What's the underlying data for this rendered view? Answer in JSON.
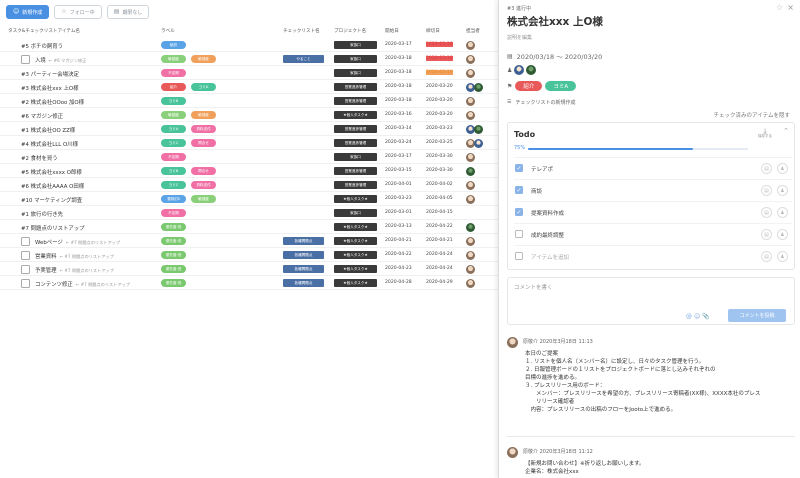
{
  "toolbar": {
    "new_label": "新規作成",
    "follow_label": "フォロー中",
    "nodue_label": "期限なし"
  },
  "table": {
    "headers": [
      "タスク&チェックリストアイテム名",
      "ラベル",
      "チェックリスト名",
      "プロジェクト名",
      "開始日",
      "締切日",
      "担当者"
    ],
    "rows": [
      {
        "title": "#5 ボチの飼育う",
        "sub": "",
        "labels": [
          {
            "t": "秘訳",
            "c": "blue"
          }
        ],
        "checklist": "",
        "project": "家族口",
        "start": "2020-03-17",
        "due": "2020-03-18",
        "due_color": "red",
        "avatars": [
          "a"
        ]
      },
      {
        "title": "入境",
        "sub": "← #6 マガジン修正",
        "checkbox": true,
        "labels": [
          {
            "t": "敏感度",
            "c": "lgreen"
          },
          {
            "t": "敏感度",
            "c": "orange"
          }
        ],
        "checklist": "やること",
        "project": "家族口",
        "start": "2020-03-18",
        "due": "2020-03-18",
        "due_color": "red",
        "avatars": [
          "a"
        ]
      },
      {
        "title": "#3 パーティー会場決定",
        "sub": "",
        "labels": [
          {
            "t": "不定期",
            "c": "pink"
          }
        ],
        "checklist": "",
        "project": "家族口",
        "start": "2020-03-18",
        "due": "2020-03-19",
        "due_color": "orange",
        "avatars": [
          "a"
        ]
      },
      {
        "title": "#3 株式会社xxx 上O様",
        "sub": "",
        "labels": [
          {
            "t": "紹介",
            "c": "red"
          },
          {
            "t": "ヨミA",
            "c": "teal"
          }
        ],
        "checklist": "",
        "project": "営業進捗管理",
        "start": "2020-03-18",
        "due": "2020-03-20",
        "due_color": "",
        "avatars": [
          "c",
          "b"
        ]
      },
      {
        "title": "#2 株式会社OOoo 加O様",
        "sub": "",
        "labels": [
          {
            "t": "ヨミB",
            "c": "teal"
          }
        ],
        "checklist": "",
        "project": "営業進捗管理",
        "start": "2020-03-18",
        "due": "2020-03-20",
        "due_color": "",
        "avatars": [
          "a"
        ]
      },
      {
        "title": "#6 マガジン修正",
        "sub": "",
        "labels": [
          {
            "t": "敏感度",
            "c": "lgreen"
          },
          {
            "t": "敏感度",
            "c": "orange"
          }
        ],
        "checklist": "",
        "project": "★個人タスク★",
        "start": "2020-03-16",
        "due": "2020-03-20",
        "due_color": "",
        "avatars": [
          "a"
        ]
      },
      {
        "title": "#1 株式会社OO ZZ様",
        "sub": "",
        "labels": [
          {
            "t": "ヨミA",
            "c": "teal"
          },
          {
            "t": "資料送付",
            "c": "pink"
          }
        ],
        "checklist": "",
        "project": "営業進捗管理",
        "start": "2020-03-14",
        "due": "2020-03-23",
        "due_color": "",
        "avatars": [
          "c",
          "b"
        ]
      },
      {
        "title": "#4 株式会社LLL O川様",
        "sub": "",
        "labels": [
          {
            "t": "ヨミC",
            "c": "teal"
          },
          {
            "t": "問合せ",
            "c": "pink"
          }
        ],
        "checklist": "",
        "project": "営業進捗管理",
        "start": "2020-03-24",
        "due": "2020-03-25",
        "due_color": "",
        "avatars": [
          "a",
          "c"
        ]
      },
      {
        "title": "#2 食材を買う",
        "sub": "",
        "labels": [
          {
            "t": "不定期",
            "c": "pink"
          }
        ],
        "checklist": "",
        "project": "家族口",
        "start": "2020-03-17",
        "due": "2020-03-30",
        "due_color": "",
        "avatars": [
          "a"
        ]
      },
      {
        "title": "#5 株式会社xxxx O郎様",
        "sub": "",
        "labels": [
          {
            "t": "ヨミB",
            "c": "teal"
          },
          {
            "t": "問合せ",
            "c": "pink"
          }
        ],
        "checklist": "",
        "project": "営業進捗管理",
        "start": "2020-03-15",
        "due": "2020-03-30",
        "due_color": "",
        "avatars": [
          "b"
        ]
      },
      {
        "title": "#6 株式会社AAAA O田様",
        "sub": "",
        "labels": [
          {
            "t": "ヨミC",
            "c": "teal"
          },
          {
            "t": "資料送付",
            "c": "pink"
          }
        ],
        "checklist": "",
        "project": "営業進捗管理",
        "start": "2020-04-01",
        "due": "2020-04-02",
        "due_color": "",
        "avatars": [
          "a"
        ]
      },
      {
        "title": "#10 マーケティング調査",
        "sub": "",
        "labels": [
          {
            "t": "要検討Ⅱ",
            "c": "blue"
          },
          {
            "t": "敏感度",
            "c": "lgreen"
          }
        ],
        "checklist": "",
        "project": "★個人タスク★",
        "start": "2020-03-23",
        "due": "2020-04-05",
        "due_color": "",
        "avatars": [
          "a"
        ]
      },
      {
        "title": "#1 旅行の行き先",
        "sub": "",
        "labels": [
          {
            "t": "不定期",
            "c": "pink"
          }
        ],
        "checklist": "",
        "project": "家族口",
        "start": "2020-03-01",
        "due": "2020-04-15",
        "due_color": "",
        "avatars": []
      },
      {
        "title": "#7 問題点のリストアップ",
        "sub": "",
        "labels": [
          {
            "t": "優先度:低",
            "c": "green"
          }
        ],
        "checklist": "",
        "project": "★個人タスク★",
        "start": "2020-03-13",
        "due": "2020-04-22",
        "due_color": "",
        "avatars": [
          "b"
        ]
      },
      {
        "title": "Webページ",
        "sub": "← #7 問題点のリストアップ",
        "checkbox": true,
        "labels": [
          {
            "t": "優先度:低",
            "c": "green"
          }
        ],
        "checklist": "各種問題点",
        "project": "★個人タスク★",
        "start": "2020-04-21",
        "due": "2020-04-21",
        "due_color": "",
        "avatars": [
          "a"
        ]
      },
      {
        "title": "営業資料",
        "sub": "← #7 問題点のリストアップ",
        "checkbox": true,
        "labels": [
          {
            "t": "優先度:低",
            "c": "green"
          }
        ],
        "checklist": "各種問題点",
        "project": "★個人タスク★",
        "start": "2020-04-22",
        "due": "2020-04-24",
        "due_color": "",
        "avatars": [
          "a"
        ]
      },
      {
        "title": "予実管理",
        "sub": "← #7 問題点のリストアップ",
        "checkbox": true,
        "labels": [
          {
            "t": "優先度:低",
            "c": "green"
          }
        ],
        "checklist": "各種問題点",
        "project": "★個人タスク★",
        "start": "2020-04-23",
        "due": "2020-04-24",
        "due_color": "",
        "avatars": [
          "a"
        ]
      },
      {
        "title": "コンテンツ修正",
        "sub": "← #7 問題点のリストアップ",
        "checkbox": true,
        "labels": [
          {
            "t": "優先度:低",
            "c": "green"
          }
        ],
        "checklist": "各種問題点",
        "project": "★個人タスク★",
        "start": "2020-04-28",
        "due": "2020-04-29",
        "due_color": "",
        "avatars": [
          "a"
        ]
      }
    ]
  },
  "panel": {
    "status": "#3 進行中",
    "title": "株式会社xxx 上O様",
    "desc_link": "説明を編集",
    "date_range": "2020/03/18 〜 2020/03/20",
    "labels": [
      {
        "t": "紹介",
        "c": "#e85a5a"
      },
      {
        "t": "ヨミA",
        "c": "#49c39a"
      }
    ],
    "new_checklist": "チェックリストの新規作成",
    "hide_checked": "チェック済みのアイテムを隠す",
    "todo": {
      "title": "Todo",
      "save_label": "保存する",
      "progress_text": "75%",
      "progress": 0.75,
      "items": [
        {
          "t": "テレアポ",
          "done": true
        },
        {
          "t": "商談",
          "done": true
        },
        {
          "t": "提案資料作成",
          "done": true
        },
        {
          "t": "成約最終調整",
          "done": false
        },
        {
          "t": "アイテムを追加",
          "done": false,
          "placeholder": true
        }
      ]
    },
    "comment_placeholder": "コメントを書く",
    "comment_button": "コメントを投稿",
    "comments": [
      {
        "author_time": "原敬介 2020年3月18日 11:13",
        "body": "本日のご提案\n１. リストを個人名（メンバー名）に設定し、日々のタスク管理を行う。\n２. 日報管理ボードの１リストをプロジェクトボードに落とし込みそれぞれの\n目標の進捗を進める。\n３. プレスリリース用のボード：\n　　メンバー：プレスリリースを希望の方、プレスリリース寄稿者(XX様)、XXXX本社のプレス\n　　リリース確認者\n　内容：プレスリリースの出稿のフローをJooto上で進める。"
      },
      {
        "author_time": "原敬介 2020年3月18日 11:12",
        "body": "【新規お問い合わせ】※折り返しお願いします。\n企業名：株式会社xxx"
      }
    ]
  }
}
